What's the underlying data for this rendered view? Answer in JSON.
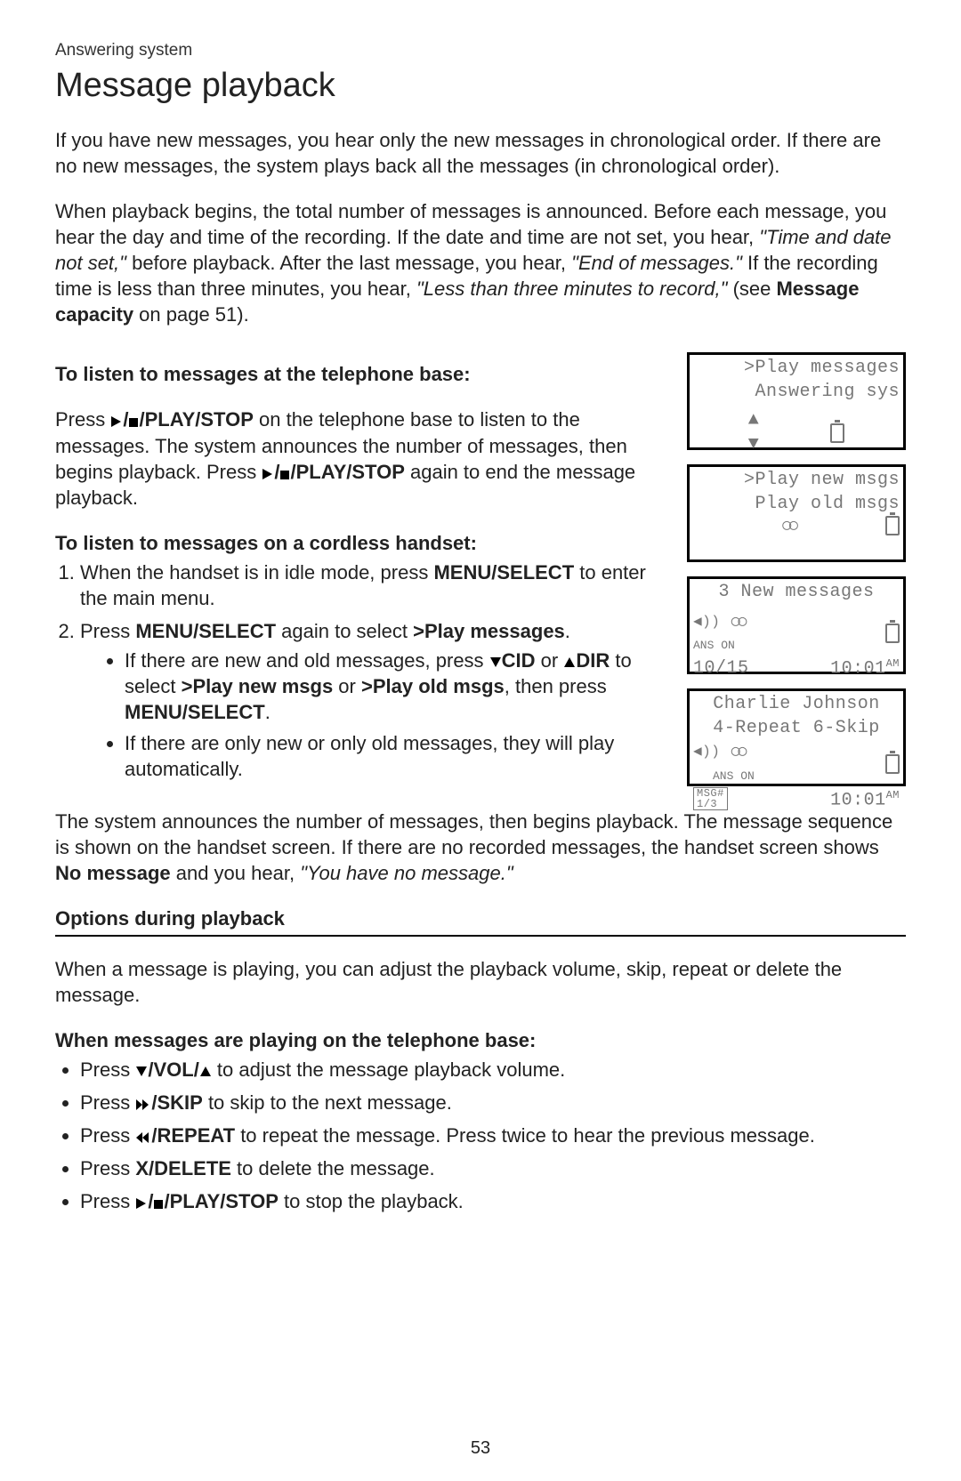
{
  "category": "Answering system",
  "title": "Message playback",
  "intro": "If you have new messages, you hear only the new messages in chronological order. If there are no new messages, the system plays back all the messages (in chronological order).",
  "para2_a": "When playback begins, the total number of messages is announced. Before each message, you hear the day and time of the recording. If the date and time are not set, you hear, ",
  "para2_q1": "\"Time and date not set,\"",
  "para2_b": " before playback. After the last message, you hear, ",
  "para2_q2": "\"End of messages.\"",
  "para2_c": " If the recording time is less than three minutes, you hear, ",
  "para2_q3": "\"Less than three minutes to record,\"",
  "para2_d": " (see ",
  "para2_bold": "Message capacity",
  "para2_e": " on page 51).",
  "base_heading": "To listen to messages at the telephone base:",
  "base_a": "Press ",
  "base_key1a": "/PLAY/",
  "base_key1b": "STOP",
  "base_b": " on the telephone base to listen to the messages. The system announces the number of messages, then begins playback. Press ",
  "base_key2a": "/",
  "base_key2b": "PLAY",
  "base_key2c": "/STOP",
  "base_c": " again to end the message playback.",
  "hs_heading": "To listen to messages on a cordless handset:",
  "hs1_a": "When the handset is in idle mode, press ",
  "hs1_key1": "MENU/",
  "hs1_key2": "SELECT",
  "hs1_b": " to enter the main menu.",
  "hs2_a": "Press ",
  "hs2_key1": "MENU",
  "hs2_key2": "/SELECT",
  "hs2_b": " again to select ",
  "hs2_sel": ">Play messages",
  "hs2_c": ".",
  "hs2_b1_a": "If there are new and old messages, press ",
  "hs2_b1_k1": "CID",
  "hs2_b1_mid": " or ",
  "hs2_b1_k2": "DIR",
  "hs2_b1_b": " to select ",
  "hs2_b1_s1": ">Play new msgs",
  "hs2_b1_or": " or ",
  "hs2_b1_s2": ">Play old msgs",
  "hs2_b1_c": ", then press ",
  "hs2_b1_k3a": "MENU",
  "hs2_b1_k3b": "/SELECT",
  "hs2_b1_d": ".",
  "hs2_b2": "If there are only new or only old messages, they will play automatically.",
  "after_a": "The system announces the number of messages, then begins playback. The message sequence is shown on the handset screen. If there are no recorded messages, the handset screen shows ",
  "after_bold": "No message",
  "after_b": " and you hear, ",
  "after_q": "\"You have no message.\"",
  "opt_heading": "Options during playback",
  "opt_intro": "When a message is playing, you can adjust the playback volume, skip, repeat or delete the message.",
  "opt_sub": "When messages are playing on the telephone base:",
  "opt1_a": "Press ",
  "opt1_key": "/VOL/",
  "opt1_b": " to adjust the message playback volume.",
  "opt2_a": "Press ",
  "opt2_key": "/SKIP",
  "opt2_b": " to skip to the next message.",
  "opt3_a": "Press ",
  "opt3_key": "/REPEAT",
  "opt3_b": " to repeat the message. Press twice to hear the previous message.",
  "opt4_a": "Press ",
  "opt4_key": "X/DELETE",
  "opt4_b": " to delete the message.",
  "opt5_a": "Press ",
  "opt5_key1": "/",
  "opt5_key2": "PLAY",
  "opt5_key3": "/STOP",
  "opt5_b": " to stop the playback.",
  "page_number": "53",
  "lcd1": {
    "l1": ">Play messages",
    "l2": "Answering sys"
  },
  "lcd2": {
    "l1": ">Play new msgs",
    "l2": " Play old msgs"
  },
  "lcd3": {
    "l1": "3 New messages",
    "anson": "ANS ON",
    "date": "10/15",
    "time": "10:01",
    "ampm": "AM"
  },
  "lcd4": {
    "l1": "Charlie Johnson",
    "l2": "4-Repeat 6-Skip",
    "anson": "ANS ON",
    "msg": "MSG#",
    "cnt": "1/3",
    "time": "10:01",
    "ampm": "AM"
  }
}
